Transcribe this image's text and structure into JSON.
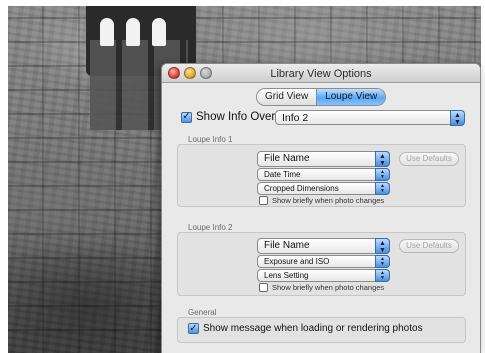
{
  "window": {
    "title": "Library View Options"
  },
  "tabs": [
    {
      "label": "Grid View",
      "active": false
    },
    {
      "label": "Loupe View",
      "active": true
    }
  ],
  "overlay": {
    "label": "Show Info Overlay",
    "checked": true,
    "selected": "Info 2"
  },
  "loupe_info_1": {
    "label": "Loupe Info 1",
    "field_1": "File Name",
    "field_2": "Date Time",
    "field_3": "Cropped Dimensions",
    "defaults_button": "Use Defaults",
    "brief_label": "Show briefly when photo changes",
    "brief_checked": false
  },
  "loupe_info_2": {
    "label": "Loupe Info 2",
    "field_1": "File Name",
    "field_2": "Exposure and ISO",
    "field_3": "Lens Setting",
    "defaults_button": "Use Defaults",
    "brief_label": "Show briefly when photo changes",
    "brief_checked": false
  },
  "general": {
    "label": "General",
    "message_label": "Show message when loading or rendering photos",
    "message_checked": true
  },
  "colors": {
    "accent": "#5ea7ef",
    "dialog_bg": "#e9e9e9"
  }
}
